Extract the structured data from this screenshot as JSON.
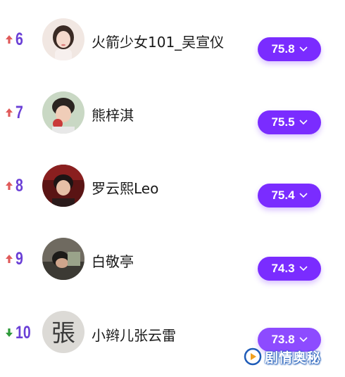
{
  "colors": {
    "accent": "#7a2cff",
    "rank_number": "#6a3fd6",
    "trend_up": "#e05a5a",
    "trend_down": "#2e9a3a"
  },
  "rows": [
    {
      "trend": "up",
      "trend_icon": "arrow-up-icon",
      "rank": "6",
      "name": "火箭少女101_吴宣仪",
      "score": "75.8"
    },
    {
      "trend": "up",
      "trend_icon": "arrow-up-icon",
      "rank": "7",
      "name": "熊梓淇",
      "score": "75.5"
    },
    {
      "trend": "up",
      "trend_icon": "arrow-up-icon",
      "rank": "8",
      "name": "罗云熙Leo",
      "score": "75.4"
    },
    {
      "trend": "up",
      "trend_icon": "arrow-up-icon",
      "rank": "9",
      "name": "白敬亭",
      "score": "74.3"
    },
    {
      "trend": "down",
      "trend_icon": "arrow-down-icon",
      "rank": "10",
      "name": "小辫儿张云雷",
      "score": "73.8"
    }
  ],
  "avatar_glyph": "張",
  "watermark": {
    "text": "剧情奥秘",
    "icon": "play-logo-icon"
  }
}
